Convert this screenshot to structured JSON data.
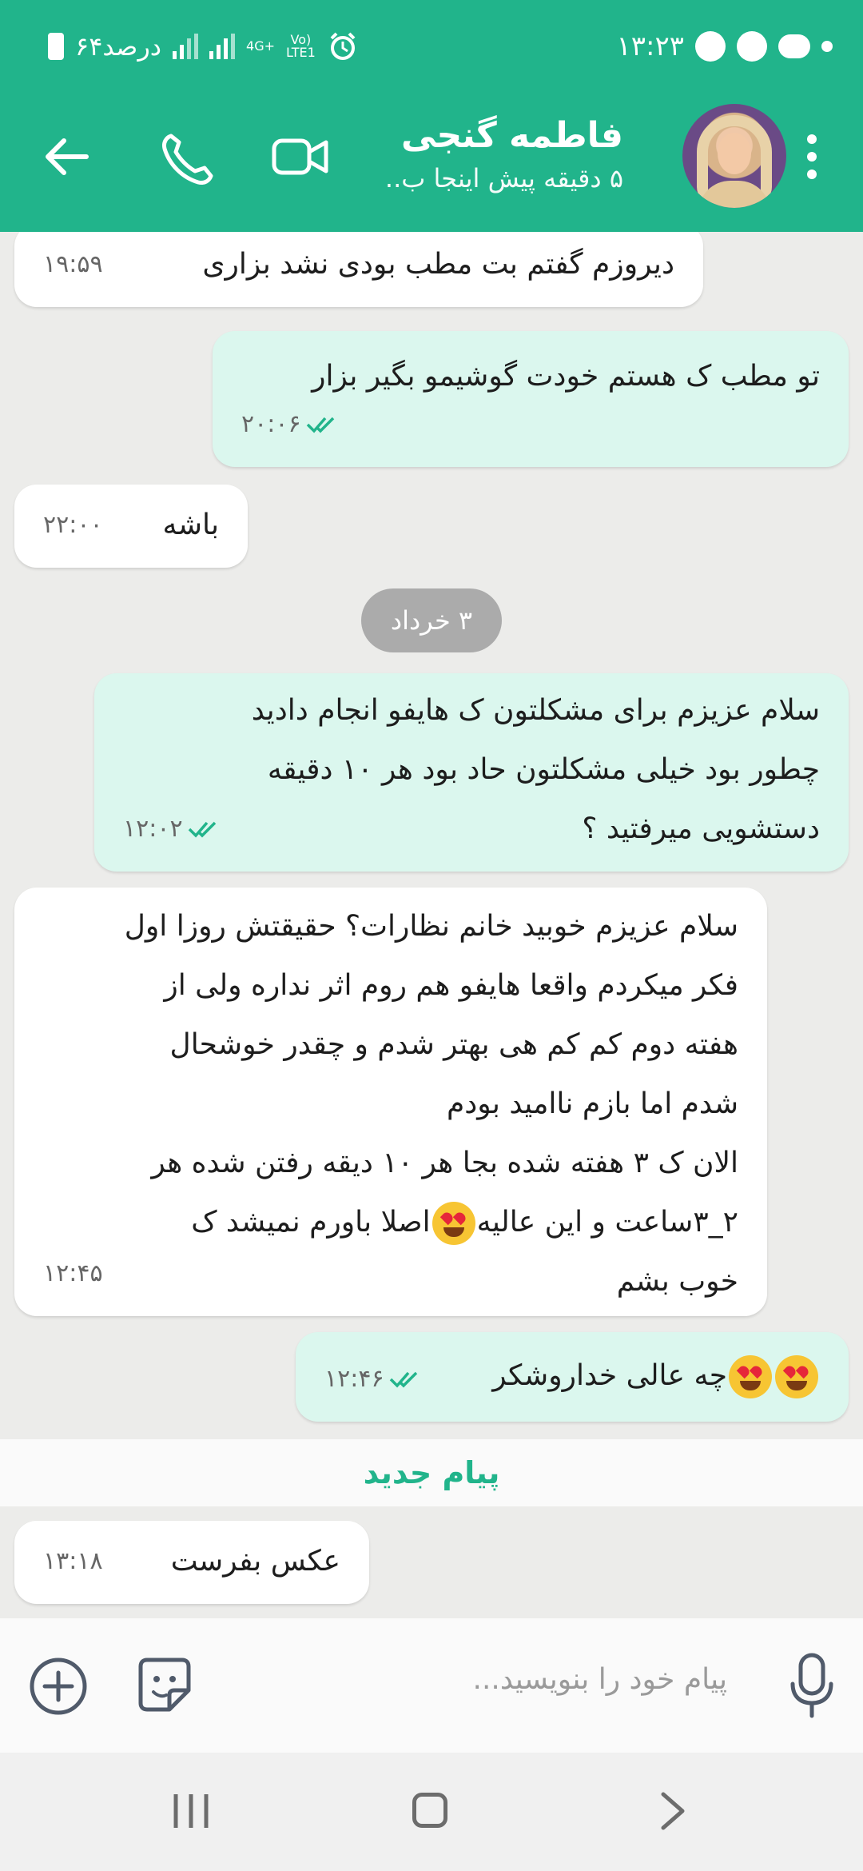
{
  "status_bar": {
    "time": "۱۳:۲۳",
    "battery_text": "۶۴درصد",
    "network_label_top": "Vo)",
    "network_label_bottom": "LTE1",
    "network_gen": "4G+"
  },
  "header": {
    "contact_name": "فاطمه گنجی",
    "status": "۵ دقیقه پیش اینجا ب..",
    "accent_color": "#21b48b"
  },
  "messages": [
    {
      "dir": "in",
      "text": "دیروزم گفتم بت مطب بودی نشد بزاری",
      "time": "۱۹:۵۹"
    },
    {
      "dir": "out",
      "text": "تو مطب ک هستم خودت گوشیمو بگیر بزار",
      "time": "۲۰:۰۶"
    },
    {
      "dir": "in",
      "text": "باشه",
      "time": "۲۲:۰۰"
    },
    {
      "dir": "out",
      "lines": [
        "سلام عزیزم برای مشکلتون ک هایفو انجام دادید",
        "چطور بود خیلی مشکلتون حاد بود هر ۱۰ دقیقه",
        "دستشویی میرفتید ؟"
      ],
      "time": "۱۲:۰۲"
    },
    {
      "dir": "in",
      "lines": [
        "سلام عزیزم خوبید خانم نظارات؟ حقیقتش روزا اول",
        "فکر میکردم واقعا هایفو هم روم اثر نداره ولی از",
        "هفته دوم کم کم هی بهتر شدم و چقدر خوشحال",
        "شدم اما بازم ناامید بودم",
        "الان ک ۳ هفته شده بجا هر ۱۰ دیقه رفتن شده هر",
        "۲_۳ساعت و این عالیه",
        "اصلا باورم نمیشد ک",
        "خوب بشم"
      ],
      "time": "۱۲:۴۵"
    },
    {
      "dir": "out",
      "text": "چه عالی خداروشکر",
      "time": "۱۲:۴۶"
    },
    {
      "dir": "in",
      "text": "عکس بفرست",
      "time": "۱۳:۱۸"
    }
  ],
  "date_separator": "۳ خرداد",
  "new_messages_label": "پیام جدید",
  "composer": {
    "placeholder": "پیام خود را بنویسید..."
  },
  "icons": {
    "menu": "more-vertical-icon",
    "video": "video-camera-icon",
    "call": "phone-icon",
    "back": "arrow-left-icon",
    "attach": "plus-circle-icon",
    "sticker": "sticker-icon",
    "mic": "microphone-icon",
    "read_receipt": "double-check-icon"
  }
}
